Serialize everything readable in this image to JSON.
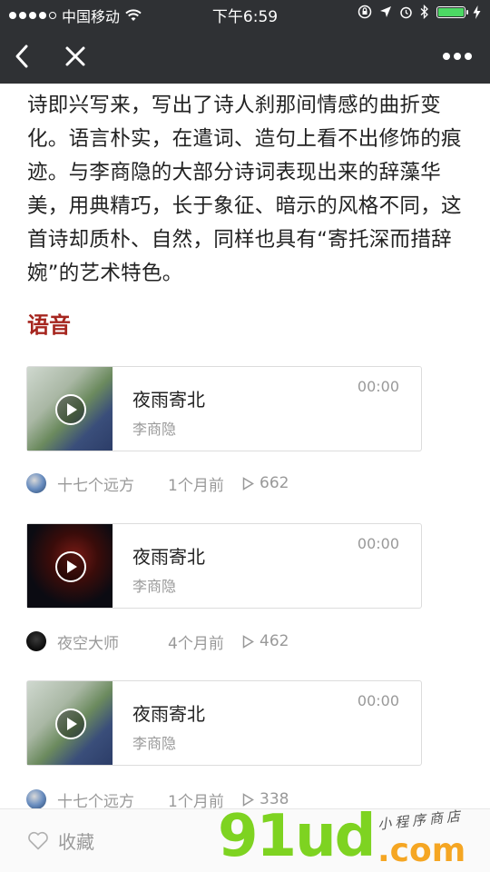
{
  "status_bar": {
    "carrier": "中国移动",
    "time": "下午6:59",
    "battery_percent": 100
  },
  "article": {
    "paragraph": "诗即兴写来，写出了诗人刹那间情感的曲折变化。语言朴实，在遣词、造句上看不出修饰的痕迹。与李商隐的大部分诗词表现出来的辞藻华美，用典精巧，长于象征、暗示的风格不同，这首诗却质朴、自然，同样也具有“寄托深而措辞婉”的艺术特色。",
    "section_title": "语音"
  },
  "audio_items": [
    {
      "title": "夜雨寄北",
      "author": "李商隐",
      "duration": "00:00",
      "thumb": "girl-photo",
      "uploader": "十七个远方",
      "posted": "1个月前",
      "plays": "662"
    },
    {
      "title": "夜雨寄北",
      "author": "李商隐",
      "duration": "00:00",
      "thumb": "iron-man-photo",
      "uploader": "夜空大师",
      "posted": "4个月前",
      "plays": "462"
    },
    {
      "title": "夜雨寄北",
      "author": "李商隐",
      "duration": "00:00",
      "thumb": "girl-photo",
      "uploader": "十七个远方",
      "posted": "1个月前",
      "plays": "338"
    }
  ],
  "bottom_bar": {
    "favorite_label": "收藏"
  },
  "watermark": {
    "brand": "91ud",
    "suffix": ".com",
    "tagline": "小程序商店"
  },
  "colors": {
    "nav_bg": "#2f3134",
    "section_title": "#a6261f",
    "muted_text": "#999999",
    "battery": "#4cd964"
  }
}
